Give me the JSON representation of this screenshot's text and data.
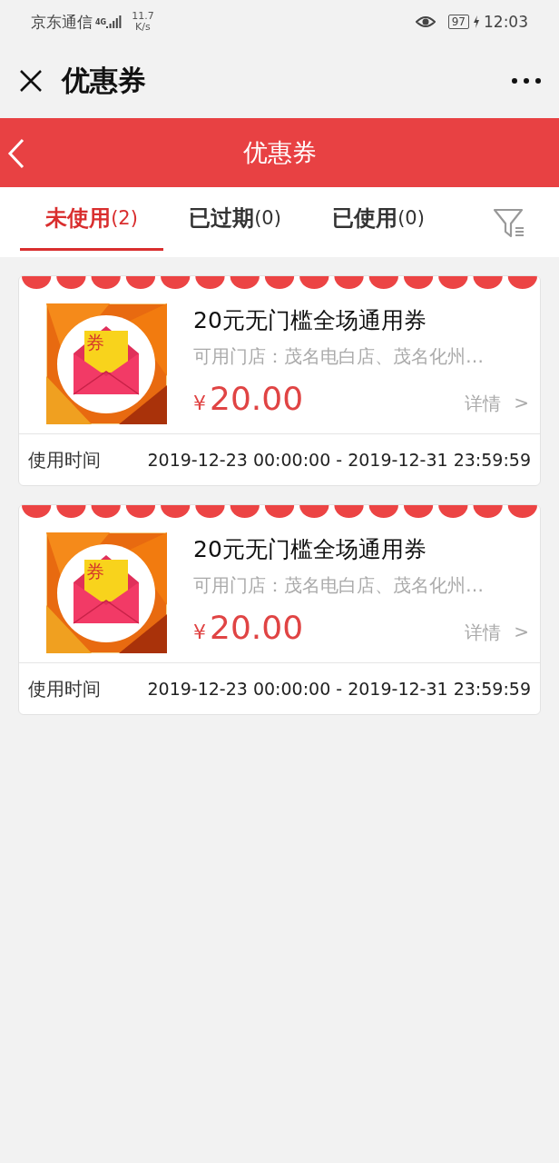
{
  "status_bar": {
    "carrier": "京东通信",
    "network": "4G",
    "speed_value": "11.7",
    "speed_unit": "K/s",
    "battery": "97",
    "time": "12:03"
  },
  "title_bar": {
    "title": "优惠券"
  },
  "header": {
    "title": "优惠券"
  },
  "tabs": [
    {
      "name": "未使用",
      "count": "(2)",
      "selected": true
    },
    {
      "name": "已过期",
      "count": "(0)",
      "selected": false
    },
    {
      "name": "已使用",
      "count": "(0)",
      "selected": false
    }
  ],
  "coupons": [
    {
      "image_glyph": "券",
      "title": "20元无门槛全场通用券",
      "stores": "可用门店：茂名电白店、茂名化州…",
      "currency": "¥",
      "amount": "20.00",
      "details": "详情",
      "details_arrow": ">",
      "time_label": "使用时间",
      "time_range": "2019-12-23 00:00:00 - 2019-12-31 23:59:59"
    },
    {
      "image_glyph": "券",
      "title": "20元无门槛全场通用券",
      "stores": "可用门店：茂名电白店、茂名化州…",
      "currency": "¥",
      "amount": "20.00",
      "details": "详情",
      "details_arrow": ">",
      "time_label": "使用时间",
      "time_range": "2019-12-23 00:00:00 - 2019-12-31 23:59:59"
    }
  ]
}
